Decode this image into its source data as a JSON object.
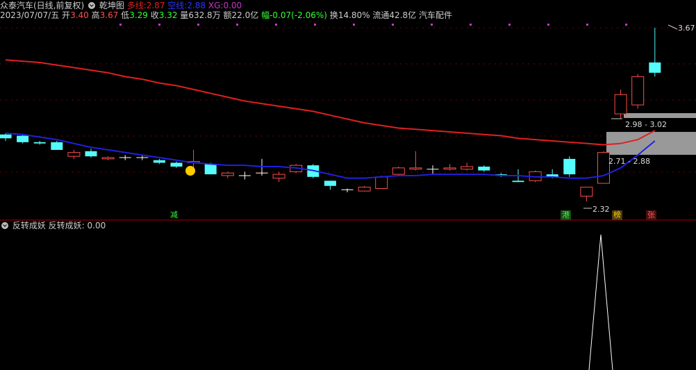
{
  "header": {
    "stock_name": "众泰汽车(日线,前复权)",
    "indicator_name": "乾坤图",
    "duo_label": "多线:",
    "duo_value": "2.87",
    "kong_label": "空线:",
    "kong_value": "2.88",
    "xg_label": "XG:",
    "xg_value": "0.00",
    "date": "2023/07/07/五",
    "open_label": "开",
    "open_value": "3.40",
    "high_label": "高",
    "high_value": "3.67",
    "low_label": "低",
    "low_value": "3.29",
    "close_label": "收",
    "close_value": "3.32",
    "vol_label": "量",
    "vol_value": "632.8万",
    "amount_label": "额",
    "amount_value": "22.0亿",
    "change_label": "幅",
    "change_value": "-0.07(-2.06%)",
    "turnover_label": "换",
    "turnover_value": "14.80%",
    "float_label": "流通",
    "float_value": "42.8亿",
    "sector": "汽车配件"
  },
  "price_labels": {
    "high": "3.67",
    "zone_upper": "2.98 - 3.02",
    "zone_lower": "2.71 - 2.88",
    "low": "2.32"
  },
  "badges": [
    {
      "text": "减",
      "color": "#33ff33"
    },
    {
      "text": "港",
      "color": "#33ff33"
    },
    {
      "text": "榜",
      "color": "#ffcc00"
    },
    {
      "text": "张",
      "color": "#ff5555"
    }
  ],
  "subchart": {
    "name": "反转成妖",
    "line_label": "反转成妖:",
    "line_value": "0.00"
  },
  "colors": {
    "up": "#ff4d4d",
    "down": "#54fcfc",
    "red_line": "#e02020",
    "blue_line": "#2020e0",
    "grid": "#7a0000",
    "marker": "#cc33cc"
  },
  "candles": [
    {
      "o": 2.84,
      "c": 2.81,
      "h": 2.85,
      "l": 2.79
    },
    {
      "o": 2.83,
      "c": 2.78,
      "h": 2.84,
      "l": 2.77
    },
    {
      "o": 2.78,
      "c": 2.77,
      "h": 2.79,
      "l": 2.76
    },
    {
      "o": 2.78,
      "c": 2.72,
      "h": 2.79,
      "l": 2.72
    },
    {
      "o": 2.67,
      "c": 2.7,
      "h": 2.72,
      "l": 2.65
    },
    {
      "o": 2.71,
      "c": 2.67,
      "h": 2.73,
      "l": 2.66
    },
    {
      "o": 2.65,
      "c": 2.66,
      "h": 2.67,
      "l": 2.64
    },
    {
      "o": 2.66,
      "c": 2.66,
      "h": 2.68,
      "l": 2.64
    },
    {
      "o": 2.66,
      "c": 2.66,
      "h": 2.68,
      "l": 2.64
    },
    {
      "o": 2.64,
      "c": 2.62,
      "h": 2.65,
      "l": 2.61
    },
    {
      "o": 2.62,
      "c": 2.59,
      "h": 2.63,
      "l": 2.58
    },
    {
      "o": 2.62,
      "c": 2.63,
      "h": 2.72,
      "l": 2.58
    },
    {
      "o": 2.61,
      "c": 2.53,
      "h": 2.62,
      "l": 2.53
    },
    {
      "o": 2.52,
      "c": 2.54,
      "h": 2.55,
      "l": 2.5
    },
    {
      "o": 2.52,
      "c": 2.52,
      "h": 2.55,
      "l": 2.49
    },
    {
      "o": 2.54,
      "c": 2.54,
      "h": 2.65,
      "l": 2.52
    },
    {
      "o": 2.5,
      "c": 2.53,
      "h": 2.55,
      "l": 2.47
    },
    {
      "o": 2.55,
      "c": 2.6,
      "h": 2.61,
      "l": 2.54
    },
    {
      "o": 2.6,
      "c": 2.51,
      "h": 2.61,
      "l": 2.5
    },
    {
      "o": 2.48,
      "c": 2.44,
      "h": 2.48,
      "l": 2.41
    },
    {
      "o": 2.41,
      "c": 2.41,
      "h": 2.42,
      "l": 2.39
    },
    {
      "o": 2.4,
      "c": 2.43,
      "h": 2.44,
      "l": 2.4
    },
    {
      "o": 2.42,
      "c": 2.51,
      "h": 2.52,
      "l": 2.42
    },
    {
      "o": 2.53,
      "c": 2.58,
      "h": 2.59,
      "l": 2.52
    },
    {
      "o": 2.57,
      "c": 2.58,
      "h": 2.71,
      "l": 2.56
    },
    {
      "o": 2.57,
      "c": 2.57,
      "h": 2.6,
      "l": 2.53
    },
    {
      "o": 2.57,
      "c": 2.58,
      "h": 2.61,
      "l": 2.56
    },
    {
      "o": 2.57,
      "c": 2.59,
      "h": 2.62,
      "l": 2.56
    },
    {
      "o": 2.59,
      "c": 2.56,
      "h": 2.6,
      "l": 2.55
    },
    {
      "o": 2.53,
      "c": 2.52,
      "h": 2.54,
      "l": 2.51
    },
    {
      "o": 2.48,
      "c": 2.47,
      "h": 2.57,
      "l": 2.47
    },
    {
      "o": 2.48,
      "c": 2.55,
      "h": 2.56,
      "l": 2.47
    },
    {
      "o": 2.53,
      "c": 2.51,
      "h": 2.57,
      "l": 2.5
    },
    {
      "o": 2.65,
      "c": 2.53,
      "h": 2.67,
      "l": 2.51
    },
    {
      "o": 2.36,
      "c": 2.43,
      "h": 2.43,
      "l": 2.32
    },
    {
      "o": 2.46,
      "c": 2.7,
      "h": 2.71,
      "l": 2.46
    },
    {
      "o": 3.0,
      "c": 3.15,
      "h": 3.19,
      "l": 2.96
    },
    {
      "o": 3.07,
      "c": 3.29,
      "h": 3.31,
      "l": 3.04
    },
    {
      "o": 3.4,
      "c": 3.32,
      "h": 3.67,
      "l": 3.29
    }
  ],
  "red_ma": [
    3.42,
    3.41,
    3.4,
    3.38,
    3.36,
    3.34,
    3.32,
    3.29,
    3.27,
    3.24,
    3.22,
    3.19,
    3.16,
    3.13,
    3.1,
    3.08,
    3.06,
    3.04,
    3.02,
    2.99,
    2.96,
    2.93,
    2.91,
    2.89,
    2.88,
    2.87,
    2.86,
    2.85,
    2.84,
    2.83,
    2.81,
    2.8,
    2.79,
    2.78,
    2.77,
    2.76,
    2.77,
    2.8,
    2.87
  ],
  "blue_ma": [
    2.85,
    2.84,
    2.82,
    2.8,
    2.77,
    2.74,
    2.72,
    2.7,
    2.68,
    2.66,
    2.64,
    2.62,
    2.61,
    2.6,
    2.6,
    2.59,
    2.59,
    2.58,
    2.56,
    2.53,
    2.5,
    2.5,
    2.51,
    2.52,
    2.52,
    2.53,
    2.53,
    2.53,
    2.53,
    2.52,
    2.52,
    2.51,
    2.51,
    2.5,
    2.5,
    2.52,
    2.58,
    2.68,
    2.79
  ]
}
